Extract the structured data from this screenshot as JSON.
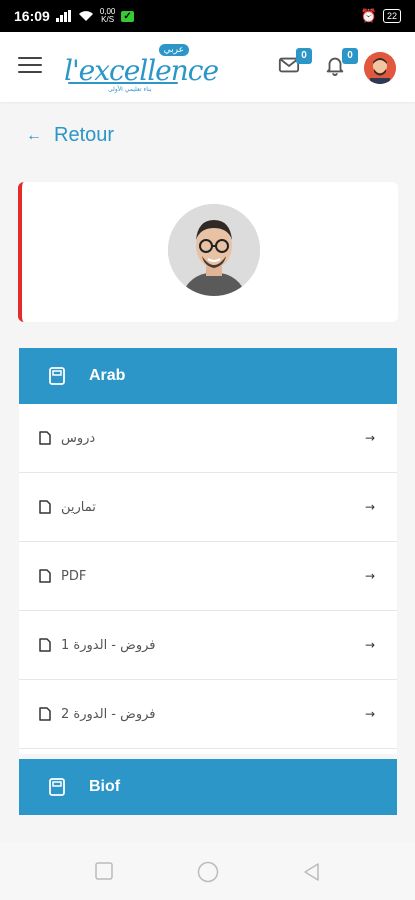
{
  "status_bar": {
    "time": "16:09",
    "network_top": "0,00",
    "network_bottom": "K/S",
    "battery": "22"
  },
  "header": {
    "logo_text": "l'excellence",
    "logo_tag": "عربي",
    "logo_sub": "بناء تعليمي الأولى",
    "messages_count": "0",
    "notifications_count": "0"
  },
  "back": {
    "arrow": "←",
    "label": "Retour"
  },
  "subjects": [
    {
      "title": "Arab",
      "items": [
        {
          "label": "دروس",
          "arrow": "→"
        },
        {
          "label": "تمارين",
          "arrow": "→"
        },
        {
          "label": "PDF",
          "arrow": "→"
        },
        {
          "label": "فروض - الدورة 1",
          "arrow": "→"
        },
        {
          "label": "فروض - الدورة 2",
          "arrow": "→"
        }
      ]
    },
    {
      "title": "Biof"
    }
  ],
  "colors": {
    "accent": "#2b96c7",
    "card_stripe": "#e32b2b"
  },
  "icons": {
    "menu": "hamburger-icon",
    "messages": "envelope-icon",
    "notifications": "bell-icon",
    "back": "arrow-left-icon",
    "subject": "notebook-icon",
    "item": "file-icon",
    "item_arrow": "arrow-right-icon"
  }
}
